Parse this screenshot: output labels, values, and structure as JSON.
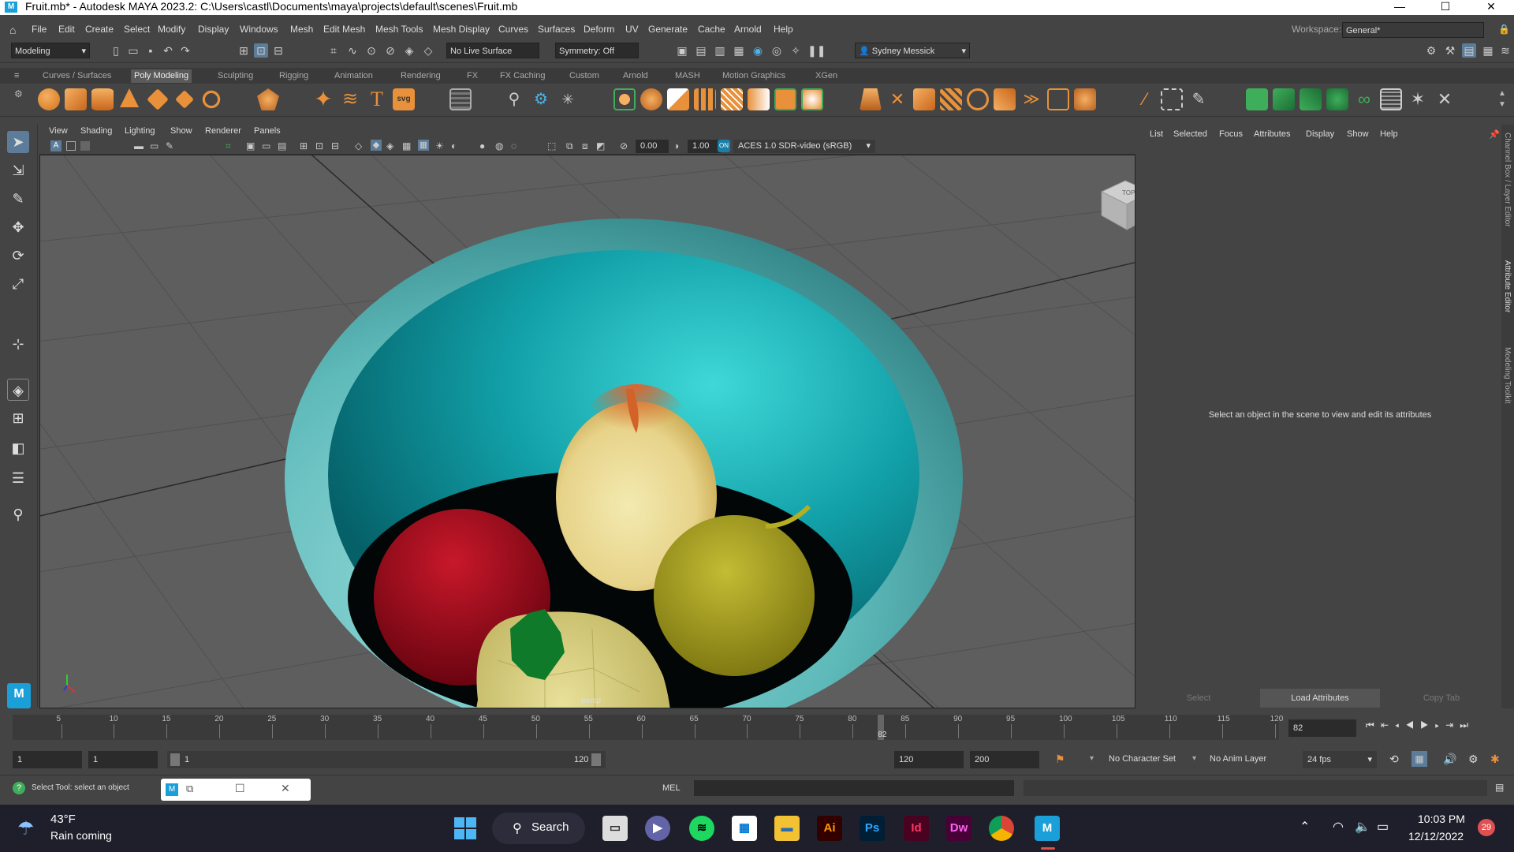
{
  "window": {
    "title": "Fruit.mb* - Autodesk MAYA 2023.2: C:\\Users\\castl\\Documents\\maya\\projects\\default\\scenes\\Fruit.mb",
    "minimize": "—",
    "maximize": "☐",
    "close": "✕"
  },
  "menubar": {
    "items": [
      "File",
      "Edit",
      "Create",
      "Select",
      "Modify",
      "Display",
      "Windows",
      "Mesh",
      "Edit Mesh",
      "Mesh Tools",
      "Mesh Display",
      "Curves",
      "Surfaces",
      "Deform",
      "UV",
      "Generate",
      "Cache",
      "Arnold",
      "Help"
    ],
    "workspace_label": "Workspace:",
    "workspace_value": "General*"
  },
  "statusline": {
    "mode": "Modeling",
    "live_surface": "No Live Surface",
    "symmetry": "Symmetry: Off",
    "user": "Sydney Messick"
  },
  "shelf": {
    "tabs": [
      "Curves / Surfaces",
      "Poly Modeling",
      "Sculpting",
      "Rigging",
      "Animation",
      "Rendering",
      "FX",
      "FX Caching",
      "Custom",
      "Arnold",
      "MASH",
      "Motion Graphics",
      "XGen"
    ],
    "active_tab": "Poly Modeling",
    "text_icon": "T",
    "svg_icon": "svg"
  },
  "viewport": {
    "menus": [
      "View",
      "Shading",
      "Lighting",
      "Show",
      "Renderer",
      "Panels"
    ],
    "field_value_1": "0.00",
    "field_value_2": "1.00",
    "color_space": "ACES 1.0 SDR-video (sRGB)",
    "camera_label": "persp",
    "viewcube_label": "TOP"
  },
  "attribute_editor": {
    "menus": [
      "List",
      "Selected",
      "Focus",
      "Attributes",
      "Display",
      "Show",
      "Help"
    ],
    "empty_message": "Select an object in the scene to view and edit its attributes",
    "buttons": [
      "Select",
      "Load Attributes",
      "Copy Tab"
    ],
    "side_tabs": [
      "Channel Box / Layer Editor",
      "Attribute Editor",
      "Modeling Toolkit"
    ]
  },
  "timeslider": {
    "ticks": [
      "5",
      "10",
      "15",
      "20",
      "25",
      "30",
      "35",
      "40",
      "45",
      "50",
      "55",
      "60",
      "65",
      "70",
      "75",
      "80",
      "85",
      "90",
      "95",
      "100",
      "105",
      "110",
      "115",
      "120"
    ],
    "current_frame": "82",
    "current_frame_field": "82",
    "current_frame_fraction": 0.6833
  },
  "rangeslider": {
    "start": "1",
    "anim_start": "1",
    "slider_start": "1",
    "slider_end": "120",
    "anim_end": "120",
    "end": "200",
    "character_set": "No Character Set",
    "anim_layer": "No Anim Layer",
    "fps": "24 fps"
  },
  "helpline": {
    "message": "Select Tool: select an object",
    "mel_label": "MEL"
  },
  "taskbar": {
    "weather_temp": "43°F",
    "weather_text": "Rain coming",
    "search_label": "Search",
    "apps": [
      "Ai",
      "Ps",
      "Id",
      "Dw"
    ],
    "time": "10:03 PM",
    "date": "12/12/2022",
    "notifications": "29"
  },
  "colors": {
    "accent_selected": "#5d7c9a",
    "shelf_orange": "#e8913a",
    "shelf_green": "#3fae5a",
    "bowl": "#6cc9c9",
    "red_fruit": "#a30d1c",
    "yellow_fruit": "#d8cf82",
    "green_fruit": "#a8a028"
  }
}
